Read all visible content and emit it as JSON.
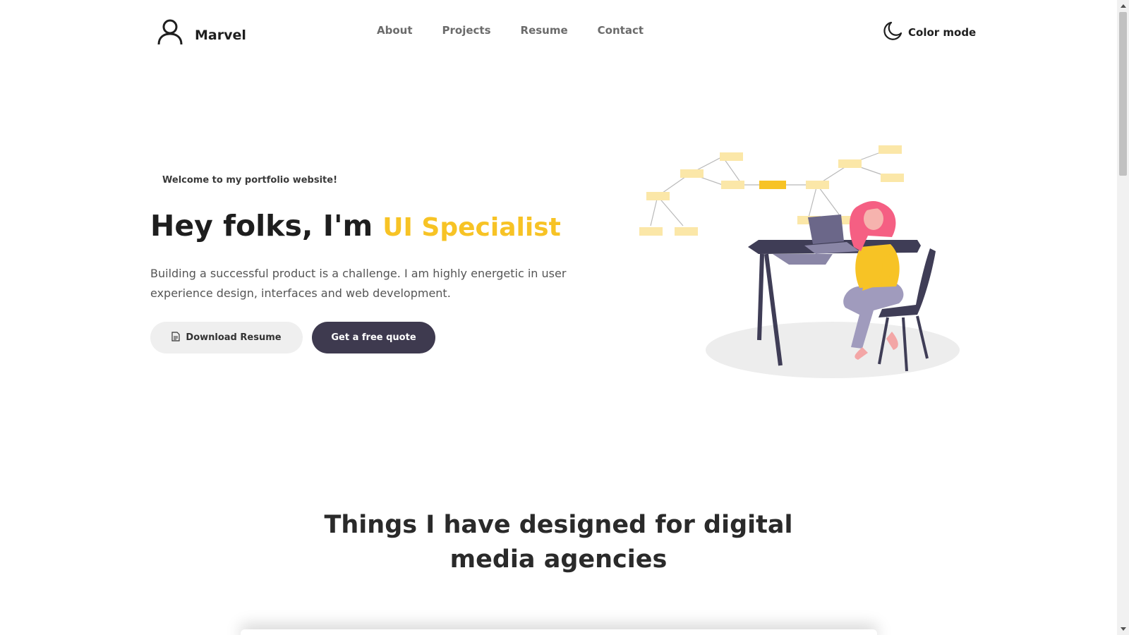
{
  "brand": {
    "name": "Marvel",
    "icon": "user-icon"
  },
  "nav": {
    "items": [
      "About",
      "Projects",
      "Resume",
      "Contact"
    ]
  },
  "color_mode": {
    "label": "Color mode",
    "icon": "moon-icon"
  },
  "hero": {
    "welcome": "Welcome to my portfolio website!",
    "headline": "Hey folks, I'm",
    "accent": "UI Specialist",
    "description": "Building a successful product is a challenge. I am highly energetic in user experience design, interfaces and web development.",
    "download_button": "Download Resume",
    "download_icon": "document-icon",
    "quote_button": "Get a free quote"
  },
  "section": {
    "title_line1": "Things I have designed for digital",
    "title_line2": "media agencies"
  },
  "colors": {
    "accent": "#f7c325",
    "dark_button": "#3e3a4f",
    "light_button": "#efefef"
  }
}
